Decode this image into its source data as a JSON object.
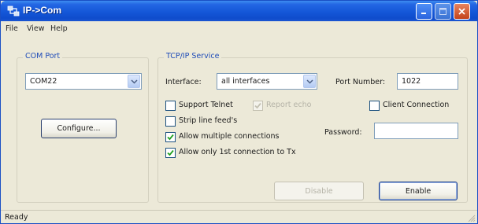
{
  "window": {
    "title": "IP->Com",
    "title_icon": "network-port-icon"
  },
  "menu": {
    "items": [
      "File",
      "View",
      "Help"
    ]
  },
  "com_port": {
    "group_title": "COM Port",
    "port_value": "COM22",
    "configure_label": "Configure..."
  },
  "tcp": {
    "group_title": "TCP/IP Service",
    "interface_label": "Interface:",
    "interface_value": "all interfaces",
    "port_number_label": "Port Number:",
    "port_number_value": "1022",
    "password_label": "Password:",
    "password_value": "",
    "checkboxes": {
      "support_telnet": {
        "label": "Support Telnet",
        "checked": false,
        "enabled": true
      },
      "report_echo": {
        "label": "Report echo",
        "checked": true,
        "enabled": false
      },
      "client_connection": {
        "label": "Client Connection",
        "checked": false,
        "enabled": true
      },
      "strip_line_feeds": {
        "label": "Strip line feed's",
        "checked": false,
        "enabled": true
      },
      "allow_multiple": {
        "label": "Allow multiple connections",
        "checked": true,
        "enabled": true
      },
      "allow_first_tx": {
        "label": "Allow only 1st connection to Tx",
        "checked": true,
        "enabled": true
      }
    },
    "disable_label": "Disable",
    "enable_label": "Enable"
  },
  "status": {
    "text": "Ready"
  },
  "colors": {
    "titlebar": "#1457d8",
    "group_title": "#1f4cb8",
    "check_mark": "#21a121",
    "window_bg": "#ece9d8"
  }
}
